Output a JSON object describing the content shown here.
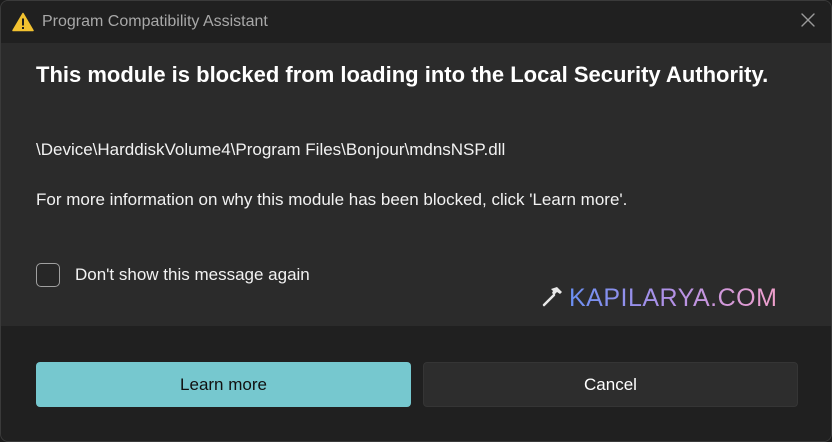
{
  "window": {
    "title": "Program Compatibility Assistant",
    "title_icon": "warning-icon",
    "close_icon": "close-icon"
  },
  "content": {
    "heading": "This module is blocked from loading into the Local Security Authority.",
    "path": "\\Device\\HarddiskVolume4\\Program Files\\Bonjour\\mdnsNSP.dll",
    "info": "For more information on why this module has been blocked, click 'Learn more'."
  },
  "checkbox": {
    "label": "Don't show this message again",
    "checked": false
  },
  "watermark": {
    "text": "KAPILARYA.COM"
  },
  "buttons": {
    "learn_more": "Learn more",
    "cancel": "Cancel"
  },
  "colors": {
    "accent": "#76c8cf",
    "warning": "#f2c230",
    "background": "#2b2b2b",
    "footer": "#202020"
  }
}
